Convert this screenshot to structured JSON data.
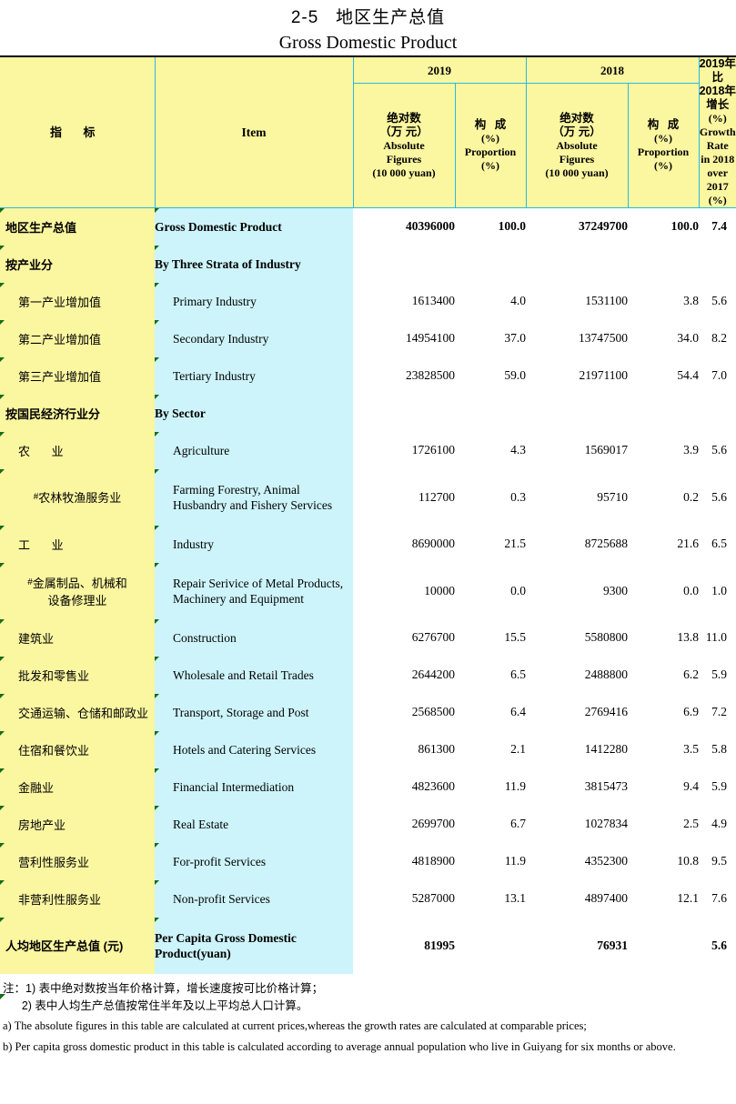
{
  "title": {
    "cn": "2-5   地区生产总值",
    "en": "Gross Domestic Product"
  },
  "header": {
    "indicator_cn": "指      标",
    "item_en": "Item",
    "year_2019": "2019",
    "year_2018": "2018",
    "absolute_cn_1": "绝对数",
    "absolute_cn_2": "（万 元）",
    "absolute_en_1": "Absolute",
    "absolute_en_2": "Figures",
    "absolute_en_3": "(10 000 yuan)",
    "proportion_cn": "构  成",
    "proportion_pct": "(%)",
    "proportion_en": "Proportion",
    "proportion_pct2": "(%)",
    "growth_cn_1": "2019年比",
    "growth_cn_2": "2018年增长",
    "growth_pct_1": "(%)",
    "growth_en_1": "Growth Rate",
    "growth_en_2": "in 2018",
    "growth_en_3": "over 2017",
    "growth_pct_2": "(%)"
  },
  "colors": {
    "indicator_bg": "#fbf6a0",
    "item_bg": "#cdf4fa",
    "grid": "#2bb8e0",
    "comment_marker": "#1a6b1a"
  },
  "rows": [
    {
      "cn": "地区生产总值",
      "en": "Gross Domestic Product",
      "abs2019": "40396000",
      "pro2019": "100.0",
      "abs2018": "37249700",
      "pro2018": "100.0",
      "growth": "7.4",
      "style": "total",
      "indent": 0,
      "hash": false
    },
    {
      "cn": "按产业分",
      "en": "By Three Strata of Industry",
      "abs2019": "",
      "pro2019": "",
      "abs2018": "",
      "pro2018": "",
      "growth": "",
      "style": "section",
      "indent": 0,
      "hash": false
    },
    {
      "cn": "第一产业增加值",
      "en": "Primary Industry",
      "abs2019": "1613400",
      "pro2019": "4.0",
      "abs2018": "1531100",
      "pro2018": "3.8",
      "growth": "5.6",
      "style": "normal",
      "indent": 1,
      "hash": false
    },
    {
      "cn": "第二产业增加值",
      "en": "Secondary Industry",
      "abs2019": "14954100",
      "pro2019": "37.0",
      "abs2018": "13747500",
      "pro2018": "34.0",
      "growth": "8.2",
      "style": "normal",
      "indent": 1,
      "hash": false
    },
    {
      "cn": "第三产业增加值",
      "en": "Tertiary Industry",
      "abs2019": "23828500",
      "pro2019": "59.0",
      "abs2018": "21971100",
      "pro2018": "54.4",
      "growth": "7.0",
      "style": "normal",
      "indent": 1,
      "hash": false
    },
    {
      "cn": "按国民经济行业分",
      "en": "By Sector",
      "abs2019": "",
      "pro2019": "",
      "abs2018": "",
      "pro2018": "",
      "growth": "",
      "style": "section",
      "indent": 0,
      "hash": false
    },
    {
      "cn": "农  业",
      "en": "Agriculture",
      "abs2019": "1726100",
      "pro2019": "4.3",
      "abs2018": "1569017",
      "pro2018": "3.9",
      "growth": "5.6",
      "style": "spaced",
      "indent": 1,
      "hash": false
    },
    {
      "cn": "农林牧渔服务业",
      "en": "Farming Forestry, Animal\nHusbandry and Fishery Services",
      "abs2019": "112700",
      "pro2019": "0.3",
      "abs2018": "95710",
      "pro2018": "0.2",
      "growth": "5.6",
      "style": "center",
      "indent": 2,
      "hash": true
    },
    {
      "cn": "工  业",
      "en": "Industry",
      "abs2019": "8690000",
      "pro2019": "21.5",
      "abs2018": "8725688",
      "pro2018": "21.6",
      "growth": "6.5",
      "style": "spaced",
      "indent": 1,
      "hash": false
    },
    {
      "cn": "金属制品、机械和\n设备修理业",
      "en": "Repair Serivice of Metal Products,\nMachinery and Equipment",
      "abs2019": "10000",
      "pro2019": "0.0",
      "abs2018": "9300",
      "pro2018": "0.0",
      "growth": "1.0",
      "style": "center",
      "indent": 2,
      "hash": true
    },
    {
      "cn": "建筑业",
      "en": "Construction",
      "abs2019": "6276700",
      "pro2019": "15.5",
      "abs2018": "5580800",
      "pro2018": "13.8",
      "growth": "11.0",
      "style": "normal",
      "indent": 1,
      "hash": false
    },
    {
      "cn": "批发和零售业",
      "en": "Wholesale and Retail Trades",
      "abs2019": "2644200",
      "pro2019": "6.5",
      "abs2018": "2488800",
      "pro2018": "6.2",
      "growth": "5.9",
      "style": "normal",
      "indent": 1,
      "hash": false
    },
    {
      "cn": "交通运输、仓储和邮政业",
      "en": "Transport, Storage and Post",
      "abs2019": "2568500",
      "pro2019": "6.4",
      "abs2018": "2769416",
      "pro2018": "6.9",
      "growth": "7.2",
      "style": "normal",
      "indent": 1,
      "hash": false
    },
    {
      "cn": "住宿和餐饮业",
      "en": "Hotels and Catering Services",
      "abs2019": "861300",
      "pro2019": "2.1",
      "abs2018": "1412280",
      "pro2018": "3.5",
      "growth": "5.8",
      "style": "normal",
      "indent": 1,
      "hash": false
    },
    {
      "cn": "金融业",
      "en": "Financial Intermediation",
      "abs2019": "4823600",
      "pro2019": "11.9",
      "abs2018": "3815473",
      "pro2018": "9.4",
      "growth": "5.9",
      "style": "normal",
      "indent": 1,
      "hash": false
    },
    {
      "cn": "房地产业",
      "en": "Real Estate",
      "abs2019": "2699700",
      "pro2019": "6.7",
      "abs2018": "1027834",
      "pro2018": "2.5",
      "growth": "4.9",
      "style": "normal",
      "indent": 1,
      "hash": false
    },
    {
      "cn": "营利性服务业",
      "en": "For-profit  Services",
      "abs2019": "4818900",
      "pro2019": "11.9",
      "abs2018": "4352300",
      "pro2018": "10.8",
      "growth": "9.5",
      "style": "normal",
      "indent": 1,
      "hash": false
    },
    {
      "cn": "非营利性服务业",
      "en": "Non-profit Services",
      "abs2019": "5287000",
      "pro2019": "13.1",
      "abs2018": "4897400",
      "pro2018": "12.1",
      "growth": "7.6",
      "style": "normal",
      "indent": 1,
      "hash": false
    },
    {
      "cn": "人均地区生产总值 (元)",
      "en": "Per Capita Gross Domestic\nProduct(yuan)",
      "abs2019": "81995",
      "pro2019": "",
      "abs2018": "76931",
      "pro2018": "",
      "growth": "5.6",
      "style": "total",
      "indent": 0,
      "hash": false
    }
  ],
  "notes": {
    "cn_1": "注：1) 表中绝对数按当年价格计算，增长速度按可比价格计算；",
    "cn_2": "      2) 表中人均生产总值按常住半年及以上平均总人口计算。",
    "en_a": "a) The absolute figures in this table are calculated at current prices,whereas the growth rates are calculated at comparable prices;",
    "en_b": "b) Per capita gross domestic product in this table is calculated according to average annual population who live in Guiyang for six months or above."
  }
}
